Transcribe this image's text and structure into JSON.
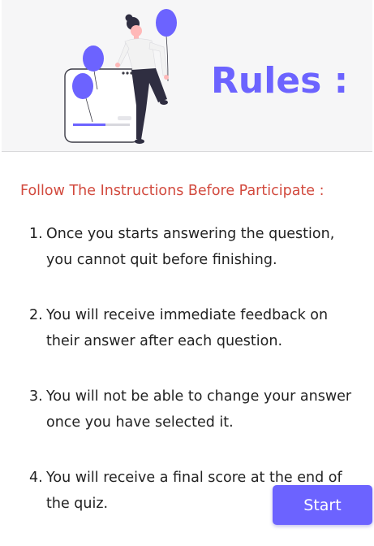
{
  "header": {
    "title": "Rules :"
  },
  "main": {
    "subtitle": "Follow The Instructions Before Participate :",
    "rules": [
      {
        "number": "1.",
        "text": "Once you starts answering the question, you cannot quit before finishing."
      },
      {
        "number": "2.",
        "text": "You will receive immediate feedback on their answer after each question."
      },
      {
        "number": "3.",
        "text": "You will not be able to change your answer once you have selected it."
      },
      {
        "number": "4.",
        "text": "You will receive a final score at the end of the quiz."
      }
    ],
    "start_label": "Start"
  },
  "colors": {
    "accent": "#6c63ff",
    "subtitle": "#d24a3e",
    "text": "#222222",
    "header_bg": "#f6f6f7"
  },
  "icons": {
    "illustration": "woman-with-balloons-and-phone-illustration"
  }
}
